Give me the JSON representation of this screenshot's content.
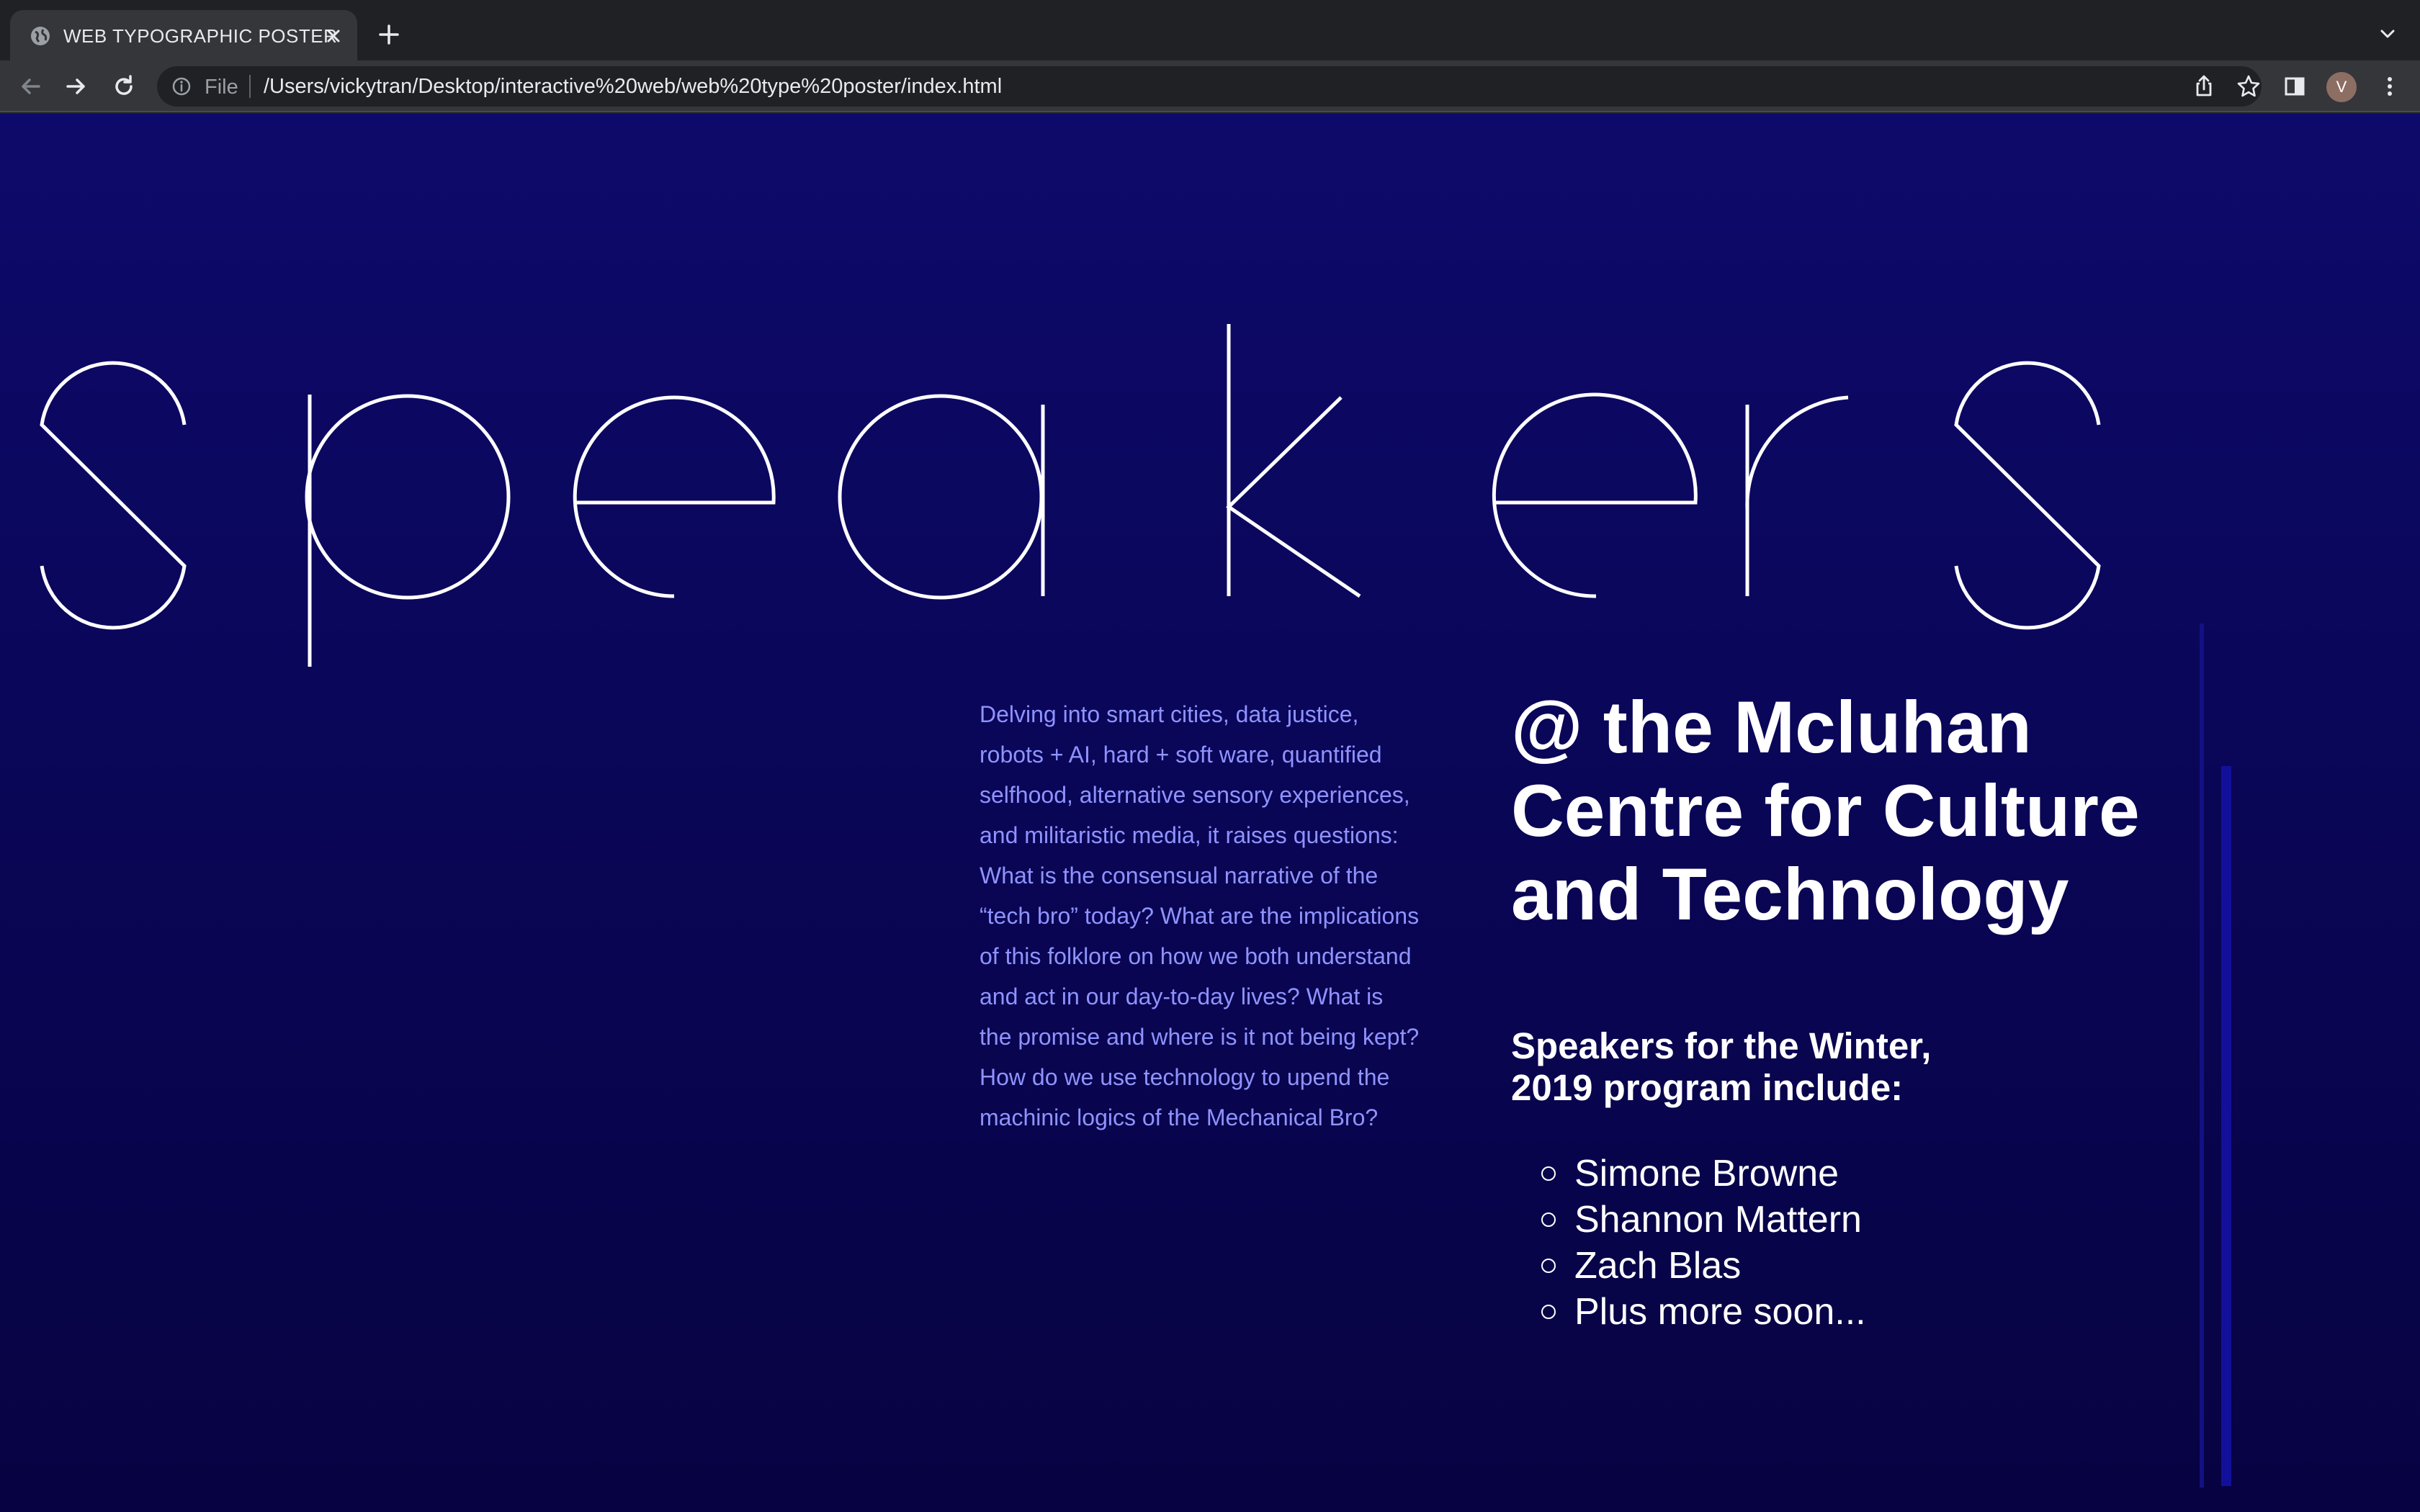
{
  "browser": {
    "tab_title": "WEB TYPOGRAPHIC POSTER",
    "omnibox_scheme": "File",
    "url": "/Users/vickytran/Desktop/interactive%20web/web%20type%20poster/index.html",
    "avatar_initial": "V"
  },
  "poster": {
    "headline": "speakers",
    "blurb": "Delving into smart cities, data justice, robots + AI, hard + soft ware, quantified selfhood, alternative sensory experiences, and militaristic media, it raises questions: What is the consensual narrative of the “tech bro” today? What are the implications of this folklore on how we both understand and act in our day-to-day lives? What is the promise and where is it not being kept? How do we use technology to upend the machinic logics of the Mechanical Bro?",
    "venue": "@ the Mcluhan Centre for Culture and Technology",
    "program_heading": "Speakers for the Winter, 2019 program include:",
    "speakers": [
      "Simone Browne",
      "Shannon Mattern",
      "Zach Blas",
      "Plus more soon..."
    ]
  },
  "colors": {
    "background_top": "#0d0a6b",
    "background_bottom": "#070342",
    "blurb_text": "#8f93ff",
    "text": "#ffffff"
  }
}
